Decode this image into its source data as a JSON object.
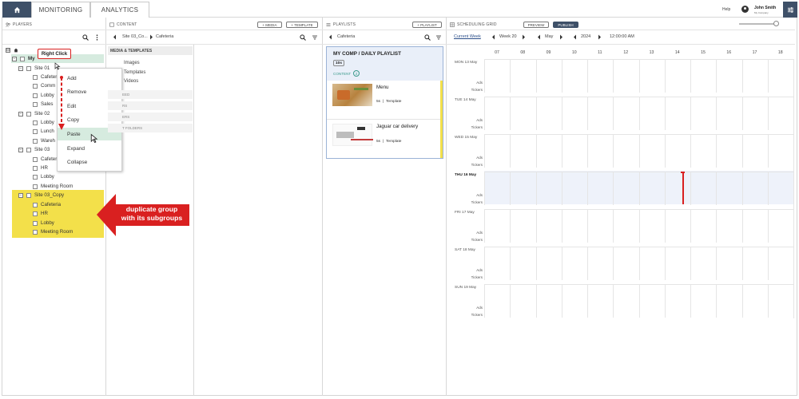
{
  "topbar": {
    "tabs": [
      "MONITORING",
      "ANALYTICS"
    ],
    "help": "Help",
    "user_name": "John Smith",
    "user_company": "My Company"
  },
  "players": {
    "title": "PLAYERS",
    "tree": {
      "root": "My",
      "site01": "Site 01",
      "site01_children": [
        "Cafeteria",
        "Comm",
        "Lobby",
        "Sales"
      ],
      "site02": "Site 02",
      "site02_children": [
        "Lobby",
        "Lunch",
        "Wareh"
      ],
      "site03": "Site 03",
      "site03_children": [
        "Cafeteria",
        "HR",
        "Lobby",
        "Meeting Room"
      ],
      "site03copy": "Site 03_Copy",
      "site03copy_children": [
        "Cafeteria",
        "HR",
        "Lobby",
        "Meeting Room"
      ]
    }
  },
  "context_menu": {
    "items": [
      "Add",
      "Remove",
      "Edit",
      "Copy",
      "Paste",
      "Expand",
      "Collapse"
    ]
  },
  "annotations": {
    "right_click": "Right Click",
    "callout": "duplicate group\nwith its subgroups"
  },
  "content": {
    "title": "CONTENT",
    "media_btn": "+ MEDIA",
    "template_btn": "+ TEMPLATE",
    "breadcrumb_1": "Site 03_Co...",
    "breadcrumb_2": "Cafeteria",
    "section": "MEDIA & TEMPLATES",
    "items": [
      "Images",
      "Templates",
      "Videos"
    ],
    "partial_sections": [
      "EED",
      "RS",
      "ERS",
      "T FOLDERS"
    ]
  },
  "playlists": {
    "title": "PLAYLISTS",
    "add_btn": "+ PLAYLIST",
    "breadcrumb": "Cafeteria",
    "card_title": "MY COMP /  DAILY PLAYLIST",
    "duration_badge": "10s",
    "content_label": "CONTENT",
    "content_count": "2",
    "items": [
      {
        "name": "Menu",
        "duration": "5s",
        "type": "Template"
      },
      {
        "name": "Jaguar car delivery",
        "duration": "5s",
        "type": "Template"
      }
    ]
  },
  "schedule": {
    "title": "SCHEDULING GRID",
    "preview_btn": "PREVIEW",
    "publish_btn": "PUBLISH",
    "current_week": "Current Week",
    "week": "Week 20",
    "month": "May",
    "year": "2024",
    "time": "12:00:00 AM",
    "hours": [
      "07",
      "08",
      "09",
      "10",
      "11",
      "12",
      "13",
      "14",
      "15",
      "16",
      "17",
      "18"
    ],
    "days": [
      "MON 13 May",
      "TUE 14 May",
      "WED 15 May",
      "THU 16 May",
      "FRI 17 May",
      "SAT 18 May",
      "SUN 19 May"
    ],
    "row_labels": [
      "Ads",
      "Tickers"
    ],
    "today_index": 3
  },
  "colors": {
    "nav_dark": "#3e5068",
    "highlight_yellow": "#f3e04a",
    "annotation_red": "#d92020",
    "selected_green": "#d6ebdf",
    "today_blue": "#eef2fa"
  }
}
